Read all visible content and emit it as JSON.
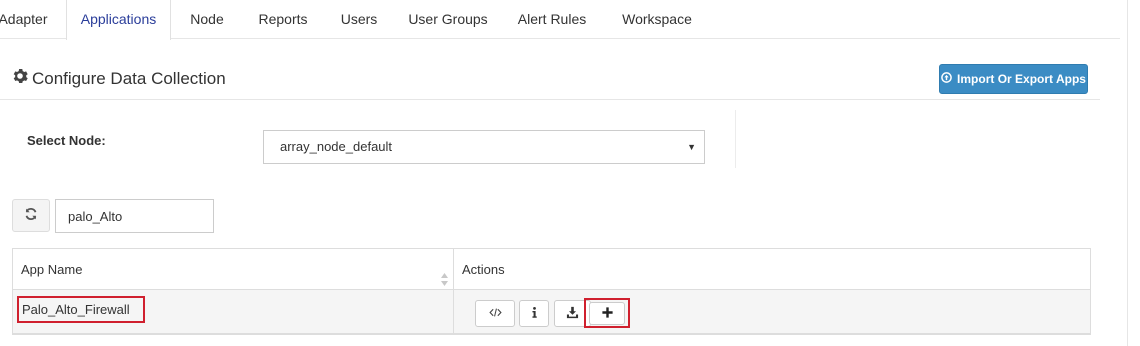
{
  "tabs": [
    {
      "label": "Adapter",
      "active": false
    },
    {
      "label": "Applications",
      "active": true
    },
    {
      "label": "Node",
      "active": false
    },
    {
      "label": "Reports",
      "active": false
    },
    {
      "label": "Users",
      "active": false
    },
    {
      "label": "User Groups",
      "active": false
    },
    {
      "label": "Alert Rules",
      "active": false
    },
    {
      "label": "Workspace",
      "active": false
    }
  ],
  "header": {
    "title": "Configure Data Collection",
    "title_icon": "gear-icon",
    "import_export_label": "Import Or Export Apps",
    "import_export_icon": "circle-arrow-up-icon"
  },
  "node_selector": {
    "label": "Select Node:",
    "selected": "array_node_default"
  },
  "filter": {
    "refresh_icon": "refresh-icon",
    "search_value": "palo_Alto"
  },
  "table": {
    "columns": [
      "App Name",
      "Actions"
    ],
    "rows": [
      {
        "app_name": "Palo_Alto_Firewall",
        "actions": [
          "code-icon",
          "info-icon",
          "download-icon",
          "plus-icon"
        ]
      }
    ]
  },
  "colors": {
    "accent_blue": "#3b8cc4",
    "active_tab_text": "#2a3d9a",
    "highlight_red": "#d0202e"
  }
}
